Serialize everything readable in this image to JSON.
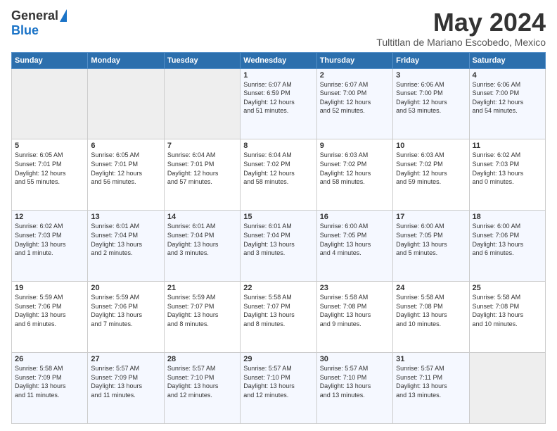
{
  "logo": {
    "general": "General",
    "blue": "Blue"
  },
  "header": {
    "month": "May 2024",
    "location": "Tultitlan de Mariano Escobedo, Mexico"
  },
  "weekdays": [
    "Sunday",
    "Monday",
    "Tuesday",
    "Wednesday",
    "Thursday",
    "Friday",
    "Saturday"
  ],
  "weeks": [
    [
      {
        "day": "",
        "info": ""
      },
      {
        "day": "",
        "info": ""
      },
      {
        "day": "",
        "info": ""
      },
      {
        "day": "1",
        "info": "Sunrise: 6:07 AM\nSunset: 6:59 PM\nDaylight: 12 hours\nand 51 minutes."
      },
      {
        "day": "2",
        "info": "Sunrise: 6:07 AM\nSunset: 7:00 PM\nDaylight: 12 hours\nand 52 minutes."
      },
      {
        "day": "3",
        "info": "Sunrise: 6:06 AM\nSunset: 7:00 PM\nDaylight: 12 hours\nand 53 minutes."
      },
      {
        "day": "4",
        "info": "Sunrise: 6:06 AM\nSunset: 7:00 PM\nDaylight: 12 hours\nand 54 minutes."
      }
    ],
    [
      {
        "day": "5",
        "info": "Sunrise: 6:05 AM\nSunset: 7:01 PM\nDaylight: 12 hours\nand 55 minutes."
      },
      {
        "day": "6",
        "info": "Sunrise: 6:05 AM\nSunset: 7:01 PM\nDaylight: 12 hours\nand 56 minutes."
      },
      {
        "day": "7",
        "info": "Sunrise: 6:04 AM\nSunset: 7:01 PM\nDaylight: 12 hours\nand 57 minutes."
      },
      {
        "day": "8",
        "info": "Sunrise: 6:04 AM\nSunset: 7:02 PM\nDaylight: 12 hours\nand 58 minutes."
      },
      {
        "day": "9",
        "info": "Sunrise: 6:03 AM\nSunset: 7:02 PM\nDaylight: 12 hours\nand 58 minutes."
      },
      {
        "day": "10",
        "info": "Sunrise: 6:03 AM\nSunset: 7:02 PM\nDaylight: 12 hours\nand 59 minutes."
      },
      {
        "day": "11",
        "info": "Sunrise: 6:02 AM\nSunset: 7:03 PM\nDaylight: 13 hours\nand 0 minutes."
      }
    ],
    [
      {
        "day": "12",
        "info": "Sunrise: 6:02 AM\nSunset: 7:03 PM\nDaylight: 13 hours\nand 1 minute."
      },
      {
        "day": "13",
        "info": "Sunrise: 6:01 AM\nSunset: 7:04 PM\nDaylight: 13 hours\nand 2 minutes."
      },
      {
        "day": "14",
        "info": "Sunrise: 6:01 AM\nSunset: 7:04 PM\nDaylight: 13 hours\nand 3 minutes."
      },
      {
        "day": "15",
        "info": "Sunrise: 6:01 AM\nSunset: 7:04 PM\nDaylight: 13 hours\nand 3 minutes."
      },
      {
        "day": "16",
        "info": "Sunrise: 6:00 AM\nSunset: 7:05 PM\nDaylight: 13 hours\nand 4 minutes."
      },
      {
        "day": "17",
        "info": "Sunrise: 6:00 AM\nSunset: 7:05 PM\nDaylight: 13 hours\nand 5 minutes."
      },
      {
        "day": "18",
        "info": "Sunrise: 6:00 AM\nSunset: 7:06 PM\nDaylight: 13 hours\nand 6 minutes."
      }
    ],
    [
      {
        "day": "19",
        "info": "Sunrise: 5:59 AM\nSunset: 7:06 PM\nDaylight: 13 hours\nand 6 minutes."
      },
      {
        "day": "20",
        "info": "Sunrise: 5:59 AM\nSunset: 7:06 PM\nDaylight: 13 hours\nand 7 minutes."
      },
      {
        "day": "21",
        "info": "Sunrise: 5:59 AM\nSunset: 7:07 PM\nDaylight: 13 hours\nand 8 minutes."
      },
      {
        "day": "22",
        "info": "Sunrise: 5:58 AM\nSunset: 7:07 PM\nDaylight: 13 hours\nand 8 minutes."
      },
      {
        "day": "23",
        "info": "Sunrise: 5:58 AM\nSunset: 7:08 PM\nDaylight: 13 hours\nand 9 minutes."
      },
      {
        "day": "24",
        "info": "Sunrise: 5:58 AM\nSunset: 7:08 PM\nDaylight: 13 hours\nand 10 minutes."
      },
      {
        "day": "25",
        "info": "Sunrise: 5:58 AM\nSunset: 7:08 PM\nDaylight: 13 hours\nand 10 minutes."
      }
    ],
    [
      {
        "day": "26",
        "info": "Sunrise: 5:58 AM\nSunset: 7:09 PM\nDaylight: 13 hours\nand 11 minutes."
      },
      {
        "day": "27",
        "info": "Sunrise: 5:57 AM\nSunset: 7:09 PM\nDaylight: 13 hours\nand 11 minutes."
      },
      {
        "day": "28",
        "info": "Sunrise: 5:57 AM\nSunset: 7:10 PM\nDaylight: 13 hours\nand 12 minutes."
      },
      {
        "day": "29",
        "info": "Sunrise: 5:57 AM\nSunset: 7:10 PM\nDaylight: 13 hours\nand 12 minutes."
      },
      {
        "day": "30",
        "info": "Sunrise: 5:57 AM\nSunset: 7:10 PM\nDaylight: 13 hours\nand 13 minutes."
      },
      {
        "day": "31",
        "info": "Sunrise: 5:57 AM\nSunset: 7:11 PM\nDaylight: 13 hours\nand 13 minutes."
      },
      {
        "day": "",
        "info": ""
      }
    ]
  ]
}
